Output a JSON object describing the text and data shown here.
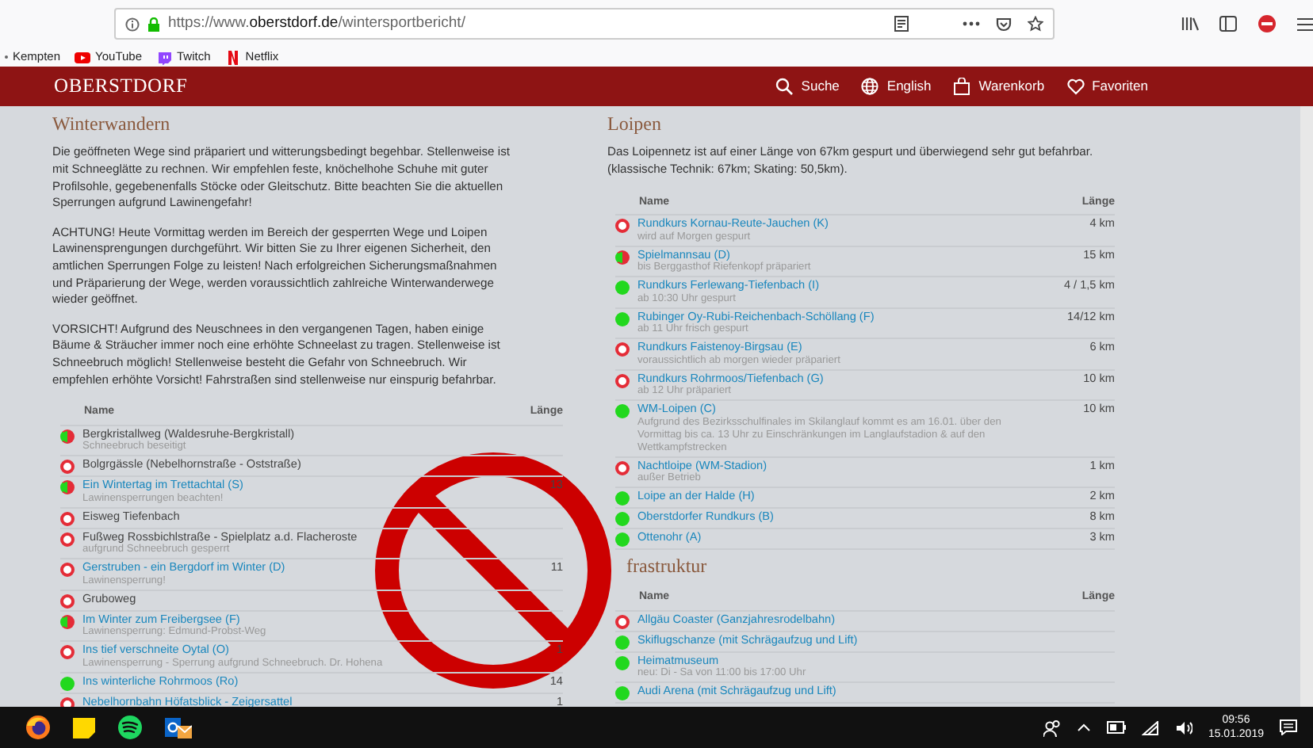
{
  "browser": {
    "url": "https://www.**oberstdorf.de**/wintersportbericht/",
    "bookmarks": [
      {
        "kind": "globe",
        "label": "Kempten"
      },
      {
        "kind": "youtube",
        "label": "YouTube"
      },
      {
        "kind": "twitch",
        "label": "Twitch"
      },
      {
        "kind": "netflix",
        "label": "Netflix"
      }
    ]
  },
  "site": {
    "logo": "OBERSTDORF",
    "nav": [
      {
        "kind": "search",
        "label": "Suche"
      },
      {
        "kind": "globe",
        "label": "English"
      },
      {
        "kind": "bag",
        "label": "Warenkorb"
      },
      {
        "kind": "heart",
        "label": "Favoriten"
      }
    ]
  },
  "winterwandern": {
    "title": "Winterwandern",
    "paragraphs": [
      "Die geöffneten Wege sind präpariert und witterungsbedingt begehbar. Stellenweise ist mit Schneeglätte zu rechnen. Wir empfehlen feste, knöchelhohe Schuhe mit guter Profilsohle, gegebenenfalls Stöcke oder Gleitschutz. Bitte beachten Sie die aktuellen Sperrungen aufgrund Lawinengefahr!",
      "ACHTUNG! Heute Vormittag werden im Bereich der gesperrten Wege und Loipen Lawinensprengungen durchgeführt. Wir bitten Sie zu Ihrer eigenen Sicherheit, den amtlichen Sperrungen Folge zu leisten! Nach erfolgreichen Sicherungsmaßnahmen und Präparierung der Wege, werden voraussichtlich zahlreiche Winterwanderwege wieder geöffnet.",
      "VORSICHT! Aufgrund des Neuschnees in den vergangenen Tagen, haben einige Bäume & Sträucher immer noch eine erhöhte Schneelast zu tragen. Stellenweise ist Schneebruch möglich! Stellenweise besteht die Gefahr von Schneebruch. Wir empfehlen erhöhte Vorsicht! Fahrstraßen sind stellenweise nur einspurig befahrbar."
    ],
    "columns": [
      "Name",
      "Länge"
    ],
    "rows": [
      {
        "name": "Bergkristallweg (Waldesruhe-Bergkristall)",
        "note": "Schneebruch beseitigt",
        "kind": "partial",
        "link": false
      },
      {
        "name": "Bolgrgässle (Nebelhornstraße - Oststraße)",
        "kind": "closed",
        "link": false
      },
      {
        "name": "Ein Wintertag im Trettachtal (S)",
        "note": "Lawinensperrungen beachten!",
        "length": "13",
        "kind": "partial",
        "link": true
      },
      {
        "name": "Eisweg Tiefenbach",
        "kind": "closed",
        "link": false
      },
      {
        "name": "Fußweg Rossbichlstraße - Spielplatz a.d. Flacheroste",
        "note": "aufgrund Schneebruch gesperrt",
        "kind": "closed",
        "link": false
      },
      {
        "name": "Gerstruben - ein Bergdorf im Winter (D)",
        "note": "Lawinensperrung!",
        "length": "11",
        "kind": "closed",
        "link": true
      },
      {
        "name": "Gruboweg",
        "kind": "closed",
        "link": false
      },
      {
        "name": "Im Winter zum Freibergsee (F)",
        "note": "Lawinensperrung: Edmund-Probst-Weg",
        "kind": "partial",
        "link": true
      },
      {
        "name": "Ins tief verschneite Oytal (O)",
        "note": "Lawinensperrung - Sperrung aufgrund Schneebruch. Dr. Hohena",
        "length": "1",
        "kind": "closed",
        "link": true
      },
      {
        "name": "Ins winterliche Rohrmoos (Ro)",
        "length": "14",
        "kind": "open",
        "link": true
      },
      {
        "name": "Nebelhornbahn Höfatsblick - Zeigersattel",
        "length": "1",
        "kind": "closed",
        "link": true
      }
    ]
  },
  "loipen": {
    "title": "Loipen",
    "paragraphs": [
      "Das Loipennetz ist auf einer Länge von 67km gespurt und überwiegend sehr gut befahrbar. (klassische Technik: 67km; Skating: 50,5km)."
    ],
    "columns": [
      "Name",
      "Länge"
    ],
    "rows": [
      {
        "name": "Rundkurs Kornau-Reute-Jauchen (K)",
        "note": "wird auf Morgen gespurt",
        "length": "4 km",
        "kind": "closed",
        "link": true
      },
      {
        "name": "Spielmannsau (D)",
        "note": "bis Berggasthof Riefenkopf präpariert",
        "length": "15 km",
        "kind": "partial",
        "link": true
      },
      {
        "name": "Rundkurs Ferlewang-Tiefenbach (I)",
        "note": "ab 10:30 Uhr gespurt",
        "length": "4 / 1,5 km",
        "kind": "open",
        "link": true
      },
      {
        "name": "Rubinger Oy-Rubi-Reichenbach-Schöllang (F)",
        "note": "ab 11 Uhr frisch gespurt",
        "length": "14/12 km",
        "kind": "open",
        "link": true
      },
      {
        "name": "Rundkurs Faistenoy-Birgsau (E)",
        "note": "voraussichtlich ab morgen wieder präpariert",
        "length": "6 km",
        "kind": "closed",
        "link": true
      },
      {
        "name": "Rundkurs Rohrmoos/Tiefenbach (G)",
        "note": "ab 12 Uhr präpariert",
        "length": "10 km",
        "kind": "closed",
        "link": true
      },
      {
        "name": "WM-Loipen (C)",
        "note": "Aufgrund des Bezirksschulfinales im Skilanglauf kommt es am 16.01. über den Vormittag bis ca. 13 Uhr zu Einschränkungen im Langlaufstadion & auf den Wettkampfstrecken",
        "length": "10 km",
        "kind": "open",
        "link": true
      },
      {
        "name": "Nachtloipe (WM-Stadion)",
        "note": "außer Betrieb",
        "length": "1 km",
        "kind": "closed",
        "link": true
      },
      {
        "name": "Loipe an der Halde (H)",
        "length": "2 km",
        "kind": "open",
        "link": true
      },
      {
        "name": "Oberstdorfer Rundkurs (B)",
        "length": "8 km",
        "kind": "open",
        "link": true
      },
      {
        "name": "Ottenohr (A)",
        "length": "3 km",
        "kind": "open",
        "link": true
      }
    ]
  },
  "infrastruktur": {
    "title": "frastruktur",
    "columns": [
      "Name",
      "Länge"
    ],
    "rows": [
      {
        "name": "Allgäu Coaster (Ganzjahresrodelbahn)",
        "kind": "closed",
        "link": true
      },
      {
        "name": "Skiflugschanze (mit Schrägaufzug und Lift)",
        "kind": "open",
        "link": true
      },
      {
        "name": "Heimatmuseum",
        "note": "neu: Di - Sa von 11:00 bis 17:00 Uhr",
        "kind": "open",
        "link": true
      },
      {
        "name": "Audi Arena (mit Schrägaufzug und Lift)",
        "kind": "open",
        "link": true
      }
    ]
  },
  "taskbar": {
    "time": "09:56",
    "date": "15.01.2019"
  }
}
